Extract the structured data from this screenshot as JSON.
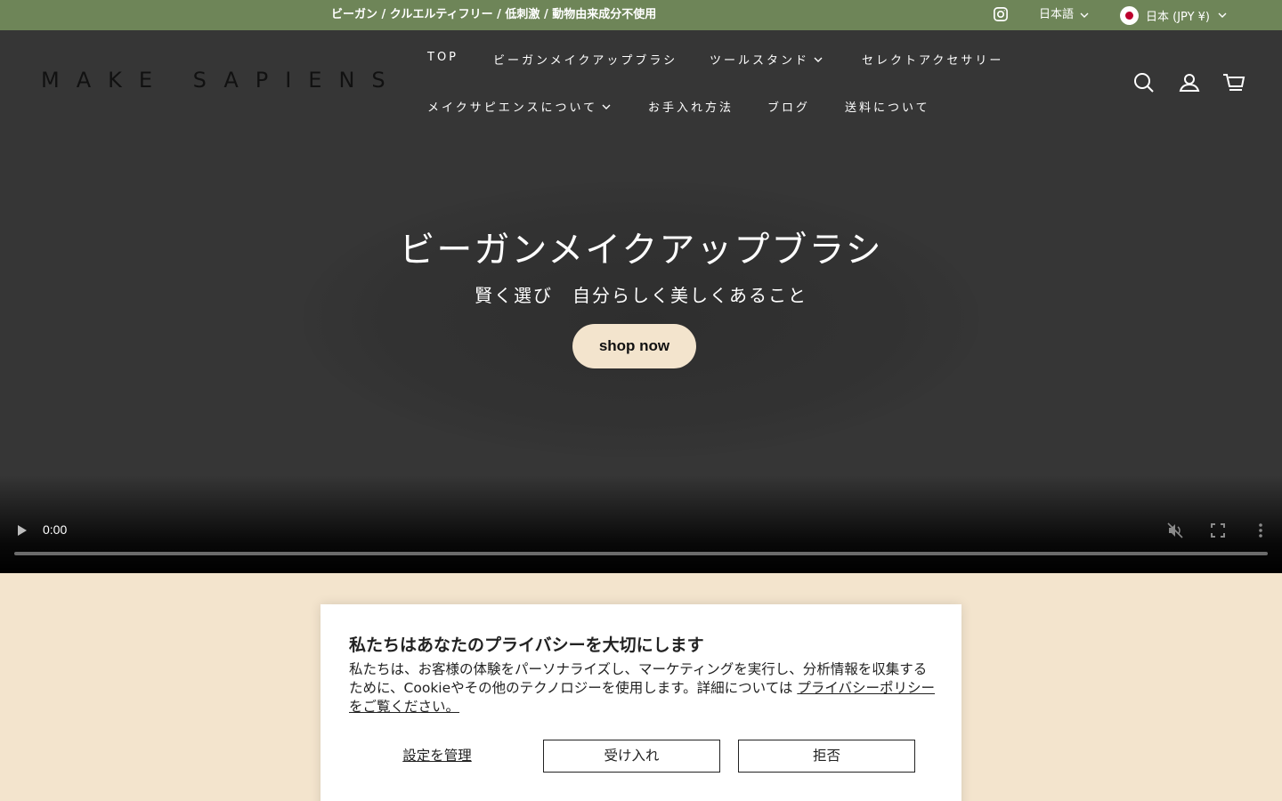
{
  "announcement": {
    "text": "ビーガン / クルエルティフリー / 低刺激 / 動物由来成分不使用",
    "language_label": "日本語",
    "country_label": "日本 (JPY ¥)"
  },
  "header": {
    "logo": "MAKE SAPIENS",
    "nav": [
      {
        "label": "TOP"
      },
      {
        "label": "ビーガンメイクアップブラシ"
      },
      {
        "label": "ツールスタンド"
      },
      {
        "label": "セレクトアクセサリー"
      },
      {
        "label": "メイクサピエンスについて"
      },
      {
        "label": "お手入れ方法"
      },
      {
        "label": "ブログ"
      },
      {
        "label": "送料について"
      }
    ]
  },
  "hero": {
    "title": "ビーガンメイクアップブラシ",
    "subtitle": "賢く選び　自分らしく美しくあること",
    "cta": "shop now"
  },
  "video": {
    "time": "0:00",
    "progress": 0
  },
  "cookie": {
    "title": "私たちはあなたのプライバシーを大切にします",
    "body": "私たちは、お客様の体験をパーソナライズし、マーケティングを実行し、分析情報を収集するために、Cookieやその他のテクノロジーを使用します。詳細については ",
    "link": "プライバシーポリシーをご覧ください。",
    "manage": "設定を管理",
    "accept": "受け入れ",
    "decline": "拒否"
  },
  "colors": {
    "announcement_bg": "#6e8558",
    "hero_bg": "#363636",
    "accent_cream": "#f3e4cd"
  },
  "icons": [
    "instagram-icon",
    "chevron-down-icon",
    "search-icon",
    "account-icon",
    "cart-icon",
    "play-icon",
    "mute-icon",
    "fullscreen-icon",
    "more-icon"
  ]
}
